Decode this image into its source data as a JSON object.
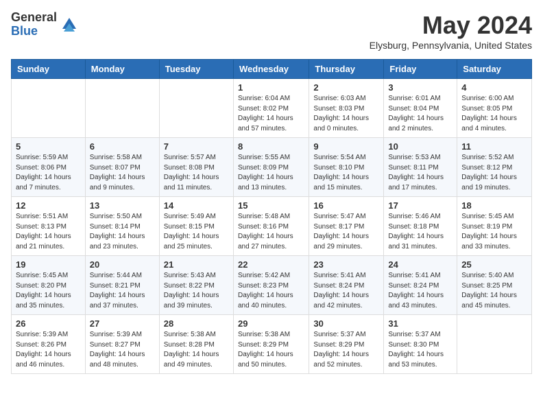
{
  "header": {
    "logo_general": "General",
    "logo_blue": "Blue",
    "title": "May 2024",
    "location": "Elysburg, Pennsylvania, United States"
  },
  "weekdays": [
    "Sunday",
    "Monday",
    "Tuesday",
    "Wednesday",
    "Thursday",
    "Friday",
    "Saturday"
  ],
  "weeks": [
    [
      {
        "day": "",
        "info": ""
      },
      {
        "day": "",
        "info": ""
      },
      {
        "day": "",
        "info": ""
      },
      {
        "day": "1",
        "info": "Sunrise: 6:04 AM\nSunset: 8:02 PM\nDaylight: 14 hours\nand 57 minutes."
      },
      {
        "day": "2",
        "info": "Sunrise: 6:03 AM\nSunset: 8:03 PM\nDaylight: 14 hours\nand 0 minutes."
      },
      {
        "day": "3",
        "info": "Sunrise: 6:01 AM\nSunset: 8:04 PM\nDaylight: 14 hours\nand 2 minutes."
      },
      {
        "day": "4",
        "info": "Sunrise: 6:00 AM\nSunset: 8:05 PM\nDaylight: 14 hours\nand 4 minutes."
      }
    ],
    [
      {
        "day": "5",
        "info": "Sunrise: 5:59 AM\nSunset: 8:06 PM\nDaylight: 14 hours\nand 7 minutes."
      },
      {
        "day": "6",
        "info": "Sunrise: 5:58 AM\nSunset: 8:07 PM\nDaylight: 14 hours\nand 9 minutes."
      },
      {
        "day": "7",
        "info": "Sunrise: 5:57 AM\nSunset: 8:08 PM\nDaylight: 14 hours\nand 11 minutes."
      },
      {
        "day": "8",
        "info": "Sunrise: 5:55 AM\nSunset: 8:09 PM\nDaylight: 14 hours\nand 13 minutes."
      },
      {
        "day": "9",
        "info": "Sunrise: 5:54 AM\nSunset: 8:10 PM\nDaylight: 14 hours\nand 15 minutes."
      },
      {
        "day": "10",
        "info": "Sunrise: 5:53 AM\nSunset: 8:11 PM\nDaylight: 14 hours\nand 17 minutes."
      },
      {
        "day": "11",
        "info": "Sunrise: 5:52 AM\nSunset: 8:12 PM\nDaylight: 14 hours\nand 19 minutes."
      }
    ],
    [
      {
        "day": "12",
        "info": "Sunrise: 5:51 AM\nSunset: 8:13 PM\nDaylight: 14 hours\nand 21 minutes."
      },
      {
        "day": "13",
        "info": "Sunrise: 5:50 AM\nSunset: 8:14 PM\nDaylight: 14 hours\nand 23 minutes."
      },
      {
        "day": "14",
        "info": "Sunrise: 5:49 AM\nSunset: 8:15 PM\nDaylight: 14 hours\nand 25 minutes."
      },
      {
        "day": "15",
        "info": "Sunrise: 5:48 AM\nSunset: 8:16 PM\nDaylight: 14 hours\nand 27 minutes."
      },
      {
        "day": "16",
        "info": "Sunrise: 5:47 AM\nSunset: 8:17 PM\nDaylight: 14 hours\nand 29 minutes."
      },
      {
        "day": "17",
        "info": "Sunrise: 5:46 AM\nSunset: 8:18 PM\nDaylight: 14 hours\nand 31 minutes."
      },
      {
        "day": "18",
        "info": "Sunrise: 5:45 AM\nSunset: 8:19 PM\nDaylight: 14 hours\nand 33 minutes."
      }
    ],
    [
      {
        "day": "19",
        "info": "Sunrise: 5:45 AM\nSunset: 8:20 PM\nDaylight: 14 hours\nand 35 minutes."
      },
      {
        "day": "20",
        "info": "Sunrise: 5:44 AM\nSunset: 8:21 PM\nDaylight: 14 hours\nand 37 minutes."
      },
      {
        "day": "21",
        "info": "Sunrise: 5:43 AM\nSunset: 8:22 PM\nDaylight: 14 hours\nand 39 minutes."
      },
      {
        "day": "22",
        "info": "Sunrise: 5:42 AM\nSunset: 8:23 PM\nDaylight: 14 hours\nand 40 minutes."
      },
      {
        "day": "23",
        "info": "Sunrise: 5:41 AM\nSunset: 8:24 PM\nDaylight: 14 hours\nand 42 minutes."
      },
      {
        "day": "24",
        "info": "Sunrise: 5:41 AM\nSunset: 8:24 PM\nDaylight: 14 hours\nand 43 minutes."
      },
      {
        "day": "25",
        "info": "Sunrise: 5:40 AM\nSunset: 8:25 PM\nDaylight: 14 hours\nand 45 minutes."
      }
    ],
    [
      {
        "day": "26",
        "info": "Sunrise: 5:39 AM\nSunset: 8:26 PM\nDaylight: 14 hours\nand 46 minutes."
      },
      {
        "day": "27",
        "info": "Sunrise: 5:39 AM\nSunset: 8:27 PM\nDaylight: 14 hours\nand 48 minutes."
      },
      {
        "day": "28",
        "info": "Sunrise: 5:38 AM\nSunset: 8:28 PM\nDaylight: 14 hours\nand 49 minutes."
      },
      {
        "day": "29",
        "info": "Sunrise: 5:38 AM\nSunset: 8:29 PM\nDaylight: 14 hours\nand 50 minutes."
      },
      {
        "day": "30",
        "info": "Sunrise: 5:37 AM\nSunset: 8:29 PM\nDaylight: 14 hours\nand 52 minutes."
      },
      {
        "day": "31",
        "info": "Sunrise: 5:37 AM\nSunset: 8:30 PM\nDaylight: 14 hours\nand 53 minutes."
      },
      {
        "day": "",
        "info": ""
      }
    ]
  ]
}
